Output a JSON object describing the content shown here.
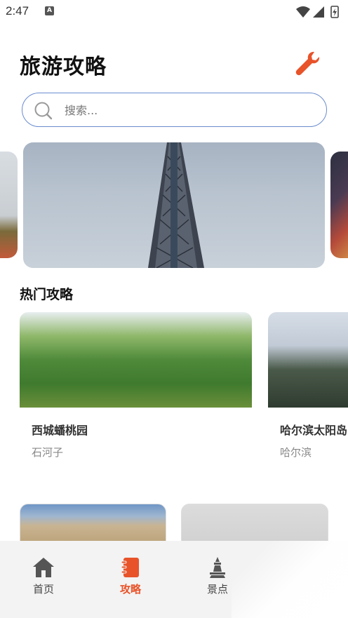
{
  "status_bar": {
    "time": "2:47"
  },
  "header": {
    "title": "旅游攻略"
  },
  "search": {
    "placeholder": "搜索..."
  },
  "section": {
    "hot_title": "热门攻略"
  },
  "hot_cards": [
    {
      "name": "西城蟠桃园",
      "city": "石河子"
    },
    {
      "name": "哈尔滨太阳岛",
      "city": "哈尔滨"
    }
  ],
  "nav": {
    "items": [
      {
        "label": "首页",
        "icon": "home-icon"
      },
      {
        "label": "攻略",
        "icon": "notebook-icon"
      },
      {
        "label": "景点",
        "icon": "tower-icon"
      }
    ],
    "active_index": 1
  },
  "colors": {
    "accent": "#e8532a",
    "search_border": "#6a8ccf"
  }
}
